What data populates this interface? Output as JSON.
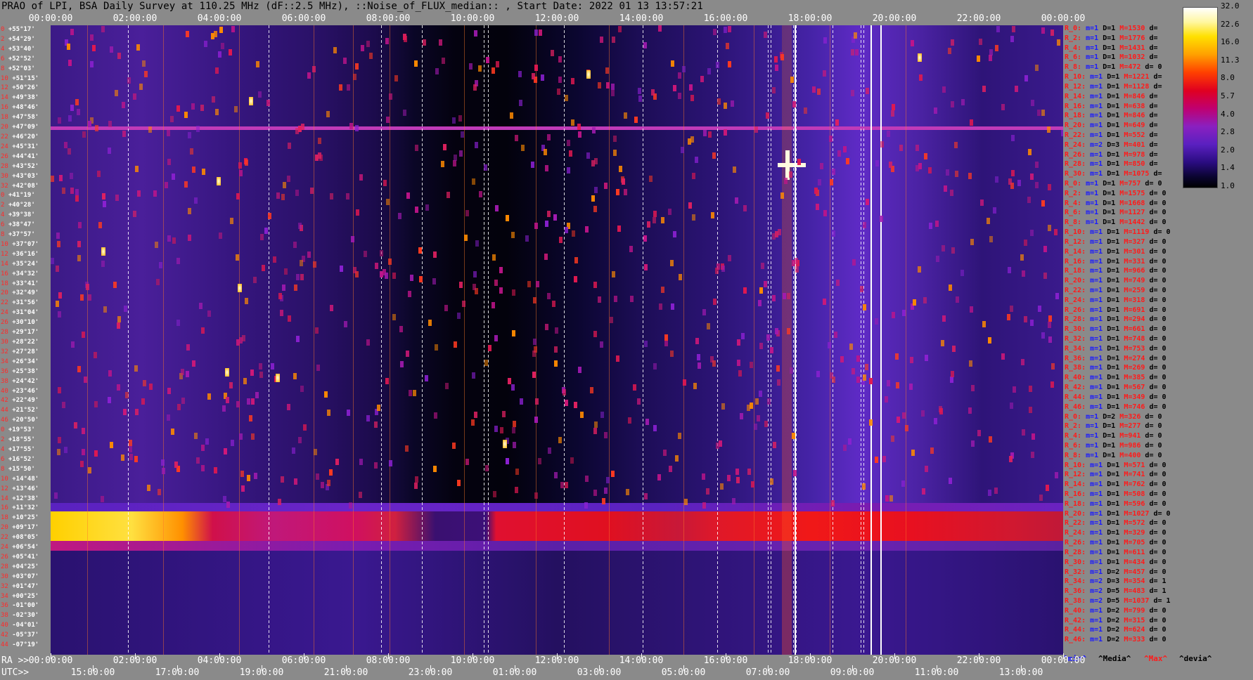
{
  "title": "PRAO of LPI, BSA Daily Survey at 110.25 MHz (dF::2.5 MHz), ::Noise_of_FLUX_median:: , Start Date: 2022 01 13 13:57:21",
  "top_axis": [
    "00:00:00",
    "02:00:00",
    "04:00:00",
    "06:00:00",
    "08:00:00",
    "10:00:00",
    "12:00:00",
    "14:00:00",
    "16:00:00",
    "18:00:00",
    "20:00:00",
    "22:00:00",
    "00:00:00"
  ],
  "bottom_ra_prefix": "RA >>",
  "bottom_ra": [
    "00:00:00",
    "02:00:00",
    "04:00:00",
    "06:00:00",
    "08:00:00",
    "10:00:00",
    "12:00:00",
    "14:00:00",
    "16:00:00",
    "18:00:00",
    "20:00:00",
    "22:00:00",
    "00:00:00"
  ],
  "bottom_utc_prefix": "UTC>>",
  "bottom_utc": [
    "15:00:00",
    "17:00:00",
    "19:00:00",
    "21:00:00",
    "23:00:00",
    "01:00:00",
    "03:00:00",
    "05:00:00",
    "07:00:00",
    "09:00:00",
    "11:00:00",
    "13:00:00"
  ],
  "declinations": [
    {
      "i": "0",
      "d": "+55°17'"
    },
    {
      "i": "2",
      "d": "+54°29'"
    },
    {
      "i": "4",
      "d": "+53°40'"
    },
    {
      "i": "6",
      "d": "+52°52'"
    },
    {
      "i": "8",
      "d": "+52°03'"
    },
    {
      "i": "10",
      "d": "+51°15'"
    },
    {
      "i": "12",
      "d": "+50°26'"
    },
    {
      "i": "14",
      "d": "+49°38'"
    },
    {
      "i": "16",
      "d": "+48°46'"
    },
    {
      "i": "18",
      "d": "+47°58'"
    },
    {
      "i": "20",
      "d": "+47°09'"
    },
    {
      "i": "22",
      "d": "+46°20'"
    },
    {
      "i": "24",
      "d": "+45°31'"
    },
    {
      "i": "26",
      "d": "+44°41'"
    },
    {
      "i": "28",
      "d": "+43°52'"
    },
    {
      "i": "30",
      "d": "+43°03'"
    },
    {
      "i": "32",
      "d": "+42°08'"
    },
    {
      "i": "0",
      "d": "+41°19'"
    },
    {
      "i": "2",
      "d": "+40°28'"
    },
    {
      "i": "4",
      "d": "+39°38'"
    },
    {
      "i": "6",
      "d": "+38°47'"
    },
    {
      "i": "8",
      "d": "+37°57'"
    },
    {
      "i": "10",
      "d": "+37°07'"
    },
    {
      "i": "12",
      "d": "+36°16'"
    },
    {
      "i": "14",
      "d": "+35°24'"
    },
    {
      "i": "16",
      "d": "+34°32'"
    },
    {
      "i": "18",
      "d": "+33°41'"
    },
    {
      "i": "20",
      "d": "+32°49'"
    },
    {
      "i": "22",
      "d": "+31°56'"
    },
    {
      "i": "24",
      "d": "+31°04'"
    },
    {
      "i": "26",
      "d": "+30°10'"
    },
    {
      "i": "28",
      "d": "+29°17'"
    },
    {
      "i": "30",
      "d": "+28°22'"
    },
    {
      "i": "32",
      "d": "+27°28'"
    },
    {
      "i": "34",
      "d": "+26°34'"
    },
    {
      "i": "36",
      "d": "+25°38'"
    },
    {
      "i": "38",
      "d": "+24°42'"
    },
    {
      "i": "40",
      "d": "+23°46'"
    },
    {
      "i": "42",
      "d": "+22°49'"
    },
    {
      "i": "44",
      "d": "+21°52'"
    },
    {
      "i": "46",
      "d": "+20°50'"
    },
    {
      "i": "0",
      "d": "+19°53'"
    },
    {
      "i": "2",
      "d": "+18°55'"
    },
    {
      "i": "4",
      "d": "+17°55'"
    },
    {
      "i": "6",
      "d": "+16°52'"
    },
    {
      "i": "8",
      "d": "+15°50'"
    },
    {
      "i": "10",
      "d": "+14°48'"
    },
    {
      "i": "12",
      "d": "+13°46'"
    },
    {
      "i": "14",
      "d": "+12°38'"
    },
    {
      "i": "16",
      "d": "+11°32'"
    },
    {
      "i": "18",
      "d": "+10°25'"
    },
    {
      "i": "20",
      "d": "+09°17'"
    },
    {
      "i": "22",
      "d": "+08°05'"
    },
    {
      "i": "24",
      "d": "+06°54'"
    },
    {
      "i": "26",
      "d": "+05°41'"
    },
    {
      "i": "28",
      "d": "+04°25'"
    },
    {
      "i": "30",
      "d": "+03°07'"
    },
    {
      "i": "32",
      "d": "+01°47'"
    },
    {
      "i": "34",
      "d": "+00°25'"
    },
    {
      "i": "36",
      "d": "-01°00'"
    },
    {
      "i": "38",
      "d": "-02°30'"
    },
    {
      "i": "40",
      "d": "-04°01'"
    },
    {
      "i": "42",
      "d": "-05°37'"
    },
    {
      "i": "44",
      "d": "-07°19'"
    }
  ],
  "right_rows": [
    {
      "r": "R_0:",
      "m": "m=1",
      "D": "D=1",
      "M": "M=1530",
      "d": "d="
    },
    {
      "r": "R_2:",
      "m": "m=1",
      "D": "D=1",
      "M": "M=1776",
      "d": "d="
    },
    {
      "r": "R_4:",
      "m": "m=1",
      "D": "D=1",
      "M": "M=1431",
      "d": "d="
    },
    {
      "r": "R_6:",
      "m": "m=1",
      "D": "D=1",
      "M": "M=1032",
      "d": "d="
    },
    {
      "r": "R_8:",
      "m": "m=1",
      "D": "D=1",
      "M": "M=472",
      "d": "d= 0"
    },
    {
      "r": "R_10:",
      "m": "m=1",
      "D": "D=1",
      "M": "M=1221",
      "d": "d="
    },
    {
      "r": "R_12:",
      "m": "m=1",
      "D": "D=1",
      "M": "M=1128",
      "d": "d="
    },
    {
      "r": "R_14:",
      "m": "m=1",
      "D": "D=1",
      "M": "M=846",
      "d": "d="
    },
    {
      "r": "R_16:",
      "m": "m=1",
      "D": "D=1",
      "M": "M=638",
      "d": "d="
    },
    {
      "r": "R_18:",
      "m": "m=1",
      "D": "D=1",
      "M": "M=846",
      "d": "d="
    },
    {
      "r": "R_20:",
      "m": "m=1",
      "D": "D=1",
      "M": "M=649",
      "d": "d="
    },
    {
      "r": "R_22:",
      "m": "m=1",
      "D": "D=1",
      "M": "M=552",
      "d": "d="
    },
    {
      "r": "R_24:",
      "m": "m=2",
      "D": "D=3",
      "M": "M=401",
      "d": "d="
    },
    {
      "r": "R_26:",
      "m": "m=1",
      "D": "D=1",
      "M": "M=978",
      "d": "d="
    },
    {
      "r": "R_28:",
      "m": "m=1",
      "D": "D=1",
      "M": "M=850",
      "d": "d="
    },
    {
      "r": "R_30:",
      "m": "m=1",
      "D": "D=1",
      "M": "M=1075",
      "d": "d="
    },
    {
      "r": "R_0:",
      "m": "m=1",
      "D": "D=1",
      "M": "M=757",
      "d": "d= 0"
    },
    {
      "r": "R_2:",
      "m": "m=1",
      "D": "D=1",
      "M": "M=1575",
      "d": "d= 0"
    },
    {
      "r": "R_4:",
      "m": "m=1",
      "D": "D=1",
      "M": "M=1668",
      "d": "d= 0"
    },
    {
      "r": "R_6:",
      "m": "m=1",
      "D": "D=1",
      "M": "M=1127",
      "d": "d= 0"
    },
    {
      "r": "R_8:",
      "m": "m=1",
      "D": "D=1",
      "M": "M=1442",
      "d": "d= 0"
    },
    {
      "r": "R_10:",
      "m": "m=1",
      "D": "D=1",
      "M": "M=1119",
      "d": "d= 0"
    },
    {
      "r": "R_12:",
      "m": "m=1",
      "D": "D=1",
      "M": "M=327",
      "d": "d= 0"
    },
    {
      "r": "R_14:",
      "m": "m=1",
      "D": "D=1",
      "M": "M=301",
      "d": "d= 0"
    },
    {
      "r": "R_16:",
      "m": "m=1",
      "D": "D=1",
      "M": "M=331",
      "d": "d= 0"
    },
    {
      "r": "R_18:",
      "m": "m=1",
      "D": "D=1",
      "M": "M=966",
      "d": "d= 0"
    },
    {
      "r": "R_20:",
      "m": "m=1",
      "D": "D=1",
      "M": "M=749",
      "d": "d= 0"
    },
    {
      "r": "R_22:",
      "m": "m=1",
      "D": "D=1",
      "M": "M=259",
      "d": "d= 0"
    },
    {
      "r": "R_24:",
      "m": "m=1",
      "D": "D=1",
      "M": "M=318",
      "d": "d= 0"
    },
    {
      "r": "R_26:",
      "m": "m=1",
      "D": "D=1",
      "M": "M=691",
      "d": "d= 0"
    },
    {
      "r": "R_28:",
      "m": "m=1",
      "D": "D=1",
      "M": "M=294",
      "d": "d= 0"
    },
    {
      "r": "R_30:",
      "m": "m=1",
      "D": "D=1",
      "M": "M=661",
      "d": "d= 0"
    },
    {
      "r": "R_32:",
      "m": "m=1",
      "D": "D=1",
      "M": "M=748",
      "d": "d= 0"
    },
    {
      "r": "R_34:",
      "m": "m=1",
      "D": "D=1",
      "M": "M=753",
      "d": "d= 0"
    },
    {
      "r": "R_36:",
      "m": "m=1",
      "D": "D=1",
      "M": "M=274",
      "d": "d= 0"
    },
    {
      "r": "R_38:",
      "m": "m=1",
      "D": "D=1",
      "M": "M=269",
      "d": "d= 0"
    },
    {
      "r": "R_40:",
      "m": "m=1",
      "D": "D=1",
      "M": "M=385",
      "d": "d= 0"
    },
    {
      "r": "R_42:",
      "m": "m=1",
      "D": "D=1",
      "M": "M=567",
      "d": "d= 0"
    },
    {
      "r": "R_44:",
      "m": "m=1",
      "D": "D=1",
      "M": "M=349",
      "d": "d= 0"
    },
    {
      "r": "R_46:",
      "m": "m=1",
      "D": "D=1",
      "M": "M=746",
      "d": "d= 0"
    },
    {
      "r": "R_0:",
      "m": "m=1",
      "D": "D=2",
      "M": "M=326",
      "d": "d= 0"
    },
    {
      "r": "R_2:",
      "m": "m=1",
      "D": "D=1",
      "M": "M=277",
      "d": "d= 0"
    },
    {
      "r": "R_4:",
      "m": "m=1",
      "D": "D=1",
      "M": "M=941",
      "d": "d= 0"
    },
    {
      "r": "R_6:",
      "m": "m=1",
      "D": "D=1",
      "M": "M=986",
      "d": "d= 0"
    },
    {
      "r": "R_8:",
      "m": "m=1",
      "D": "D=1",
      "M": "M=400",
      "d": "d= 0"
    },
    {
      "r": "R_10:",
      "m": "m=1",
      "D": "D=1",
      "M": "M=571",
      "d": "d= 0"
    },
    {
      "r": "R_12:",
      "m": "m=1",
      "D": "D=1",
      "M": "M=741",
      "d": "d= 0"
    },
    {
      "r": "R_14:",
      "m": "m=1",
      "D": "D=1",
      "M": "M=762",
      "d": "d= 0"
    },
    {
      "r": "R_16:",
      "m": "m=1",
      "D": "D=1",
      "M": "M=508",
      "d": "d= 0"
    },
    {
      "r": "R_18:",
      "m": "m=1",
      "D": "D=1",
      "M": "M=596",
      "d": "d= 0"
    },
    {
      "r": "R_20:",
      "m": "m=1",
      "D": "D=1",
      "M": "M=1027",
      "d": "d= 0"
    },
    {
      "r": "R_22:",
      "m": "m=1",
      "D": "D=1",
      "M": "M=572",
      "d": "d= 0"
    },
    {
      "r": "R_24:",
      "m": "m=1",
      "D": "D=1",
      "M": "M=329",
      "d": "d= 0"
    },
    {
      "r": "R_26:",
      "m": "m=1",
      "D": "D=1",
      "M": "M=705",
      "d": "d= 0"
    },
    {
      "r": "R_28:",
      "m": "m=1",
      "D": "D=1",
      "M": "M=611",
      "d": "d= 0"
    },
    {
      "r": "R_30:",
      "m": "m=1",
      "D": "D=1",
      "M": "M=434",
      "d": "d= 0"
    },
    {
      "r": "R_32:",
      "m": "m=1",
      "D": "D=2",
      "M": "M=457",
      "d": "d= 0"
    },
    {
      "r": "R_34:",
      "m": "m=2",
      "D": "D=3",
      "M": "M=354",
      "d": "d= 1"
    },
    {
      "r": "R_36:",
      "m": "m=2",
      "D": "D=5",
      "M": "M=483",
      "d": "d= 1"
    },
    {
      "r": "R_38:",
      "m": "m=2",
      "D": "D=5",
      "M": "M=1037",
      "d": "d= 1"
    },
    {
      "r": "R_40:",
      "m": "m=1",
      "D": "D=2",
      "M": "M=799",
      "d": "d= 0"
    },
    {
      "r": "R_42:",
      "m": "m=1",
      "D": "D=2",
      "M": "M=315",
      "d": "d= 0"
    },
    {
      "r": "R_44:",
      "m": "m=1",
      "D": "D=2",
      "M": "M=624",
      "d": "d= 0"
    },
    {
      "r": "R_46:",
      "m": "m=1",
      "D": "D=2",
      "M": "M=333",
      "d": "d= 0"
    }
  ],
  "colorbar_ticks": [
    "32.0",
    "22.6",
    "16.0",
    "11.3",
    "8.0",
    "5.7",
    "4.0",
    "2.8",
    "2.0",
    "1.4",
    "1.0"
  ],
  "legend": {
    "min": "^min^",
    "media": "^Media^",
    "max": "^Max^",
    "devia": "^devia^"
  },
  "colors": {
    "min": "#1a1aff",
    "media": "#000000",
    "max": "#ff1a1a",
    "devia": "#000000"
  }
}
